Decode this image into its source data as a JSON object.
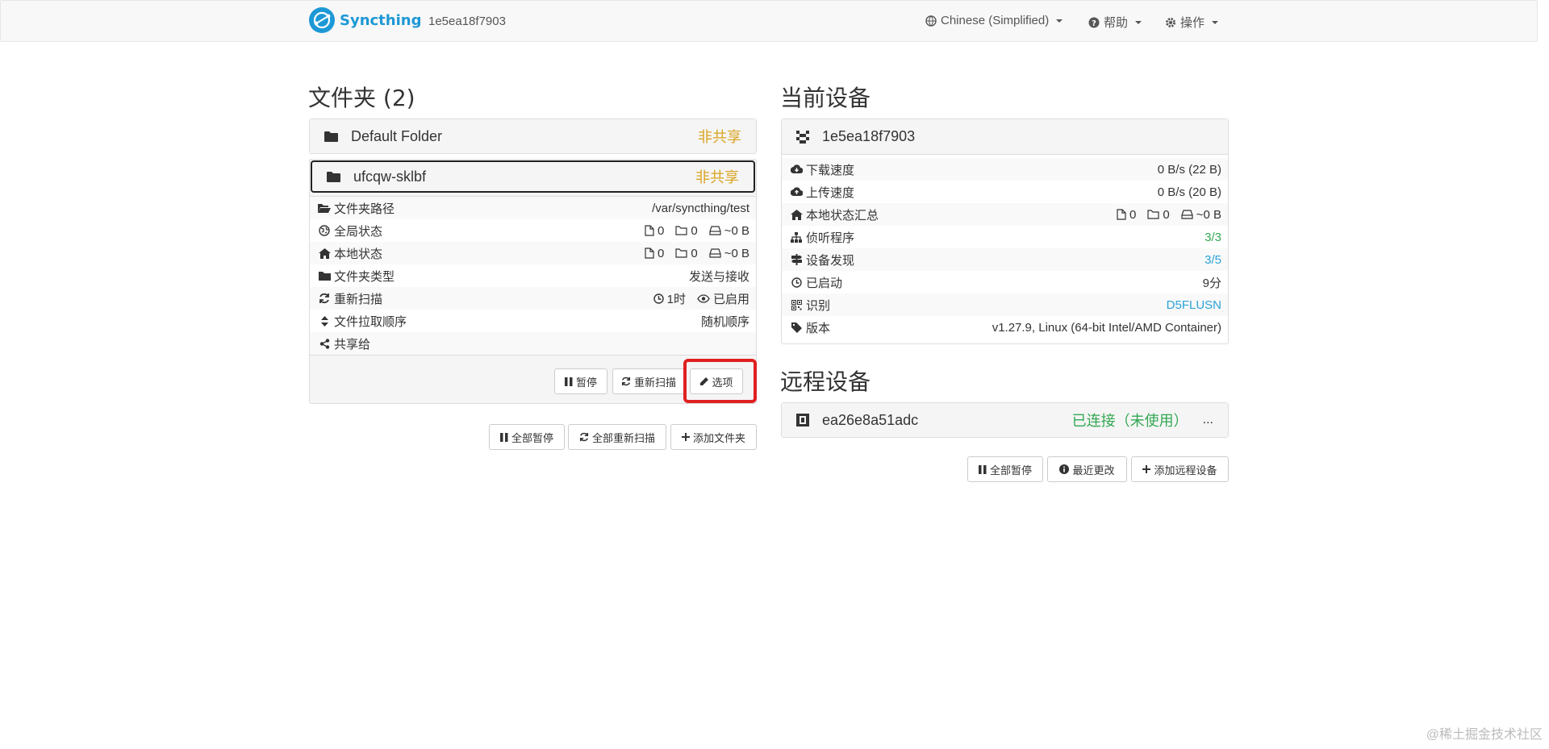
{
  "navbar": {
    "brand": "Syncthing",
    "device_id": "1e5ea18f7903",
    "language": "Chinese (Simplified)",
    "help": "帮助",
    "actions": "操作"
  },
  "folders": {
    "heading": "文件夹 (2)",
    "items": [
      {
        "name": "Default Folder",
        "status": "非共享"
      },
      {
        "name": "ufcqw-sklbf",
        "status": "非共享"
      }
    ],
    "details": {
      "path_label": "文件夹路径",
      "path_value": "/var/syncthing/test",
      "global_label": "全局状态",
      "global_files": "0",
      "global_dirs": "0",
      "global_size": "~0 B",
      "local_label": "本地状态",
      "local_files": "0",
      "local_dirs": "0",
      "local_size": "~0 B",
      "type_label": "文件夹类型",
      "type_value": "发送与接收",
      "rescan_label": "重新扫描",
      "rescan_interval": "1时",
      "rescan_watch": "已启用",
      "order_label": "文件拉取顺序",
      "order_value": "随机顺序",
      "shared_label": "共享给",
      "shared_value": ""
    },
    "buttons": {
      "pause": "暂停",
      "rescan": "重新扫描",
      "options": "选项"
    },
    "footer_buttons": {
      "pause_all": "全部暂停",
      "rescan_all": "全部重新扫描",
      "add_folder": "添加文件夹"
    }
  },
  "this_device": {
    "heading": "当前设备",
    "name": "1e5ea18f7903",
    "rows": {
      "download_label": "下载速度",
      "download_value": "0 B/s (22 B)",
      "upload_label": "上传速度",
      "upload_value": "0 B/s (20 B)",
      "local_label": "本地状态汇总",
      "local_files": "0",
      "local_dirs": "0",
      "local_size": "~0 B",
      "listeners_label": "侦听程序",
      "listeners_value": "3/3",
      "discovery_label": "设备发现",
      "discovery_value": "3/5",
      "uptime_label": "已启动",
      "uptime_value": "9分",
      "id_label": "识别",
      "id_value": "D5FLUSN",
      "version_label": "版本",
      "version_value": "v1.27.9, Linux (64-bit Intel/AMD Container)"
    }
  },
  "remote_devices": {
    "heading": "远程设备",
    "items": [
      {
        "name": "ea26e8a51adc",
        "status": "已连接（未使用）",
        "more": "..."
      }
    ],
    "footer_buttons": {
      "pause_all": "全部暂停",
      "recent_changes": "最近更改",
      "add_device": "添加远程设备"
    }
  },
  "watermark": "@稀土掘金技术社区",
  "colors": {
    "brand": "#1d98d6",
    "unshared": "#d9a420",
    "connected": "#33a852",
    "link": "#2ca3d8",
    "highlight": "#e02020"
  }
}
